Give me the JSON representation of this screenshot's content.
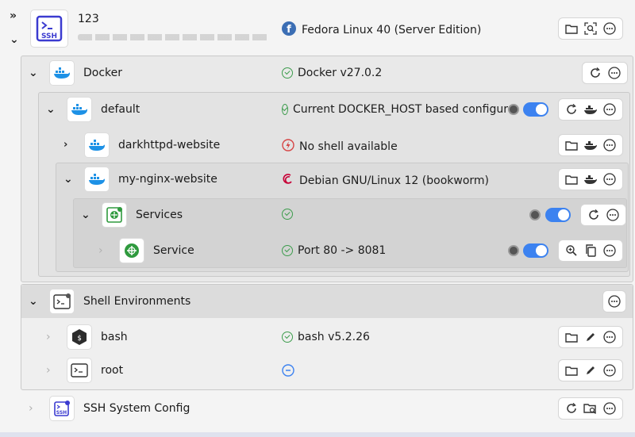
{
  "top": {
    "name": "123",
    "status": "Fedora Linux 40 (Server Edition)",
    "ssh_badge": "SSH"
  },
  "docker": {
    "name": "Docker",
    "status": "Docker v27.0.2"
  },
  "default": {
    "name": "default",
    "status": "Current DOCKER_HOST based configuration"
  },
  "darkhttpd": {
    "name": "darkhttpd-website",
    "status": "No shell available"
  },
  "nginx": {
    "name": "my-nginx-website",
    "status": "Debian GNU/Linux 12 (bookworm)"
  },
  "services": {
    "name": "Services"
  },
  "service": {
    "name": "Service",
    "status": "Port 80 -> 8081"
  },
  "shellenv": {
    "name": "Shell Environments"
  },
  "bash": {
    "name": "bash",
    "status": "bash v5.2.26"
  },
  "root": {
    "name": "root"
  },
  "sshconfig": {
    "name": "SSH System Config"
  },
  "colors": {
    "accent": "#3c82f0",
    "ok": "#3c9c4c",
    "error": "#d64545"
  }
}
